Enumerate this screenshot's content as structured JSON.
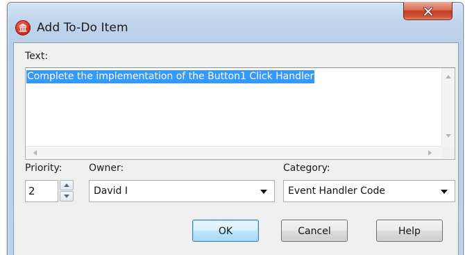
{
  "window": {
    "title": "Add To-Do Item",
    "icon": "app-icon",
    "close_icon": "close-icon"
  },
  "text_field": {
    "label": "Text:",
    "value": "Complete the implementation of the Button1 Click Handler"
  },
  "priority": {
    "label": "Priority:",
    "value": "2"
  },
  "owner": {
    "label": "Owner:",
    "value": "David I"
  },
  "category": {
    "label": "Category:",
    "value": "Event Handler Code"
  },
  "buttons": {
    "ok": "OK",
    "cancel": "Cancel",
    "help": "Help"
  },
  "colors": {
    "selection": "#3399ff",
    "close_button": "#c43b22",
    "frame": "#bcd2ea",
    "client": "#f0f0f0"
  }
}
